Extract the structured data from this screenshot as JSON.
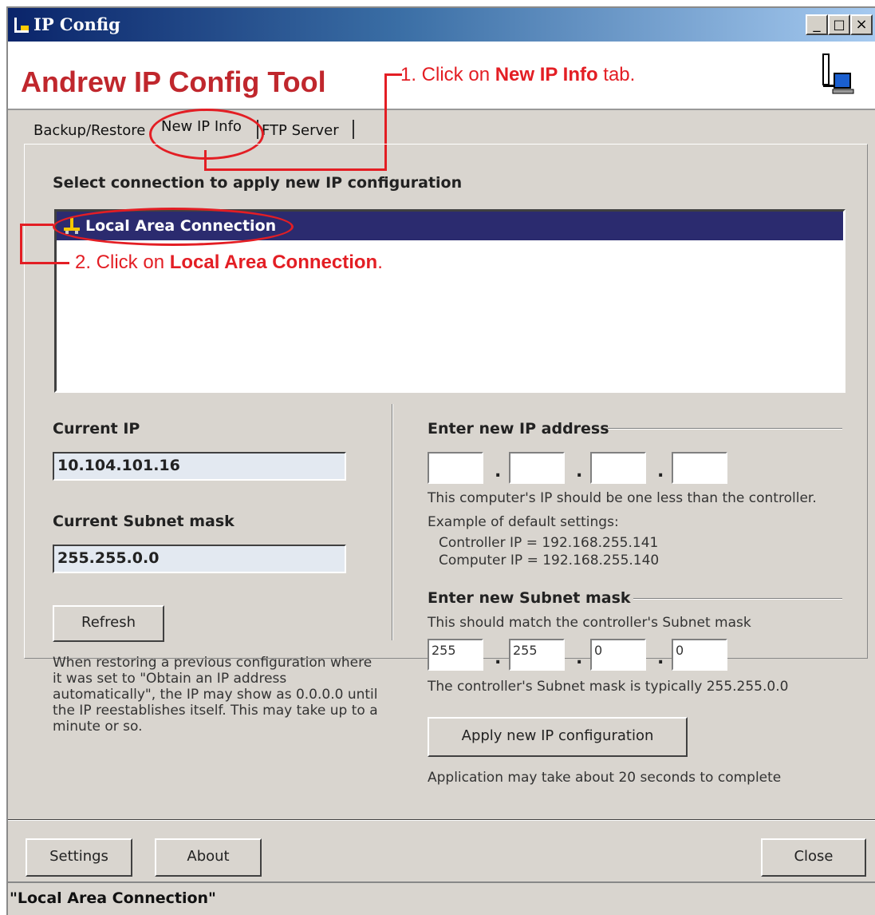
{
  "window": {
    "title": "IP Config",
    "min": "_",
    "max": "□",
    "close": "×"
  },
  "header": {
    "app_title": "Andrew IP Config Tool"
  },
  "annotations": {
    "step1_prefix": "1.  Click on ",
    "step1_bold": "New IP Info",
    "step1_suffix": " tab.",
    "step2_prefix": "2.  Click on ",
    "step2_bold": "Local Area Connection",
    "step2_suffix": ".",
    "color": "#e31e24"
  },
  "tabs": [
    {
      "label": "Backup/Restore"
    },
    {
      "label": "New IP Info"
    },
    {
      "label": "FTP Server"
    }
  ],
  "connection": {
    "heading": "Select connection to apply new IP configuration",
    "items": [
      {
        "label": "Local Area Connection",
        "icon": "network-icon"
      }
    ]
  },
  "current": {
    "ip_label": "Current IP",
    "ip_value": "10.104.101.16",
    "mask_label": "Current Subnet mask",
    "mask_value": "255.255.0.0",
    "refresh_label": "Refresh",
    "note": "When restoring a previous configuration where it was set to \"Obtain an IP address automatically\", the IP may show as 0.0.0.0 until the IP reestablishes itself.  This may take up to a minute or so."
  },
  "new_ip": {
    "heading": "Enter new IP address",
    "octets": [
      "",
      "",
      "",
      ""
    ],
    "hint": "This computer's IP should be one less than the controller.",
    "example_heading": "Example of default settings:",
    "example_controller": "Controller IP = 192.168.255.141",
    "example_computer": "Computer IP = 192.168.255.140"
  },
  "new_mask": {
    "heading": "Enter new Subnet mask",
    "hint": "This should match the controller's Subnet mask",
    "octets": [
      "255",
      "255",
      "0",
      "0"
    ],
    "typical": "The controller's Subnet mask is typically 255.255.0.0"
  },
  "apply": {
    "button_label": "Apply new IP configuration",
    "note": "Application may take about 20 seconds to complete"
  },
  "footer": {
    "settings_label": "Settings",
    "about_label": "About",
    "close_label": "Close"
  },
  "status_bar": {
    "text": "\"Local Area Connection\""
  }
}
